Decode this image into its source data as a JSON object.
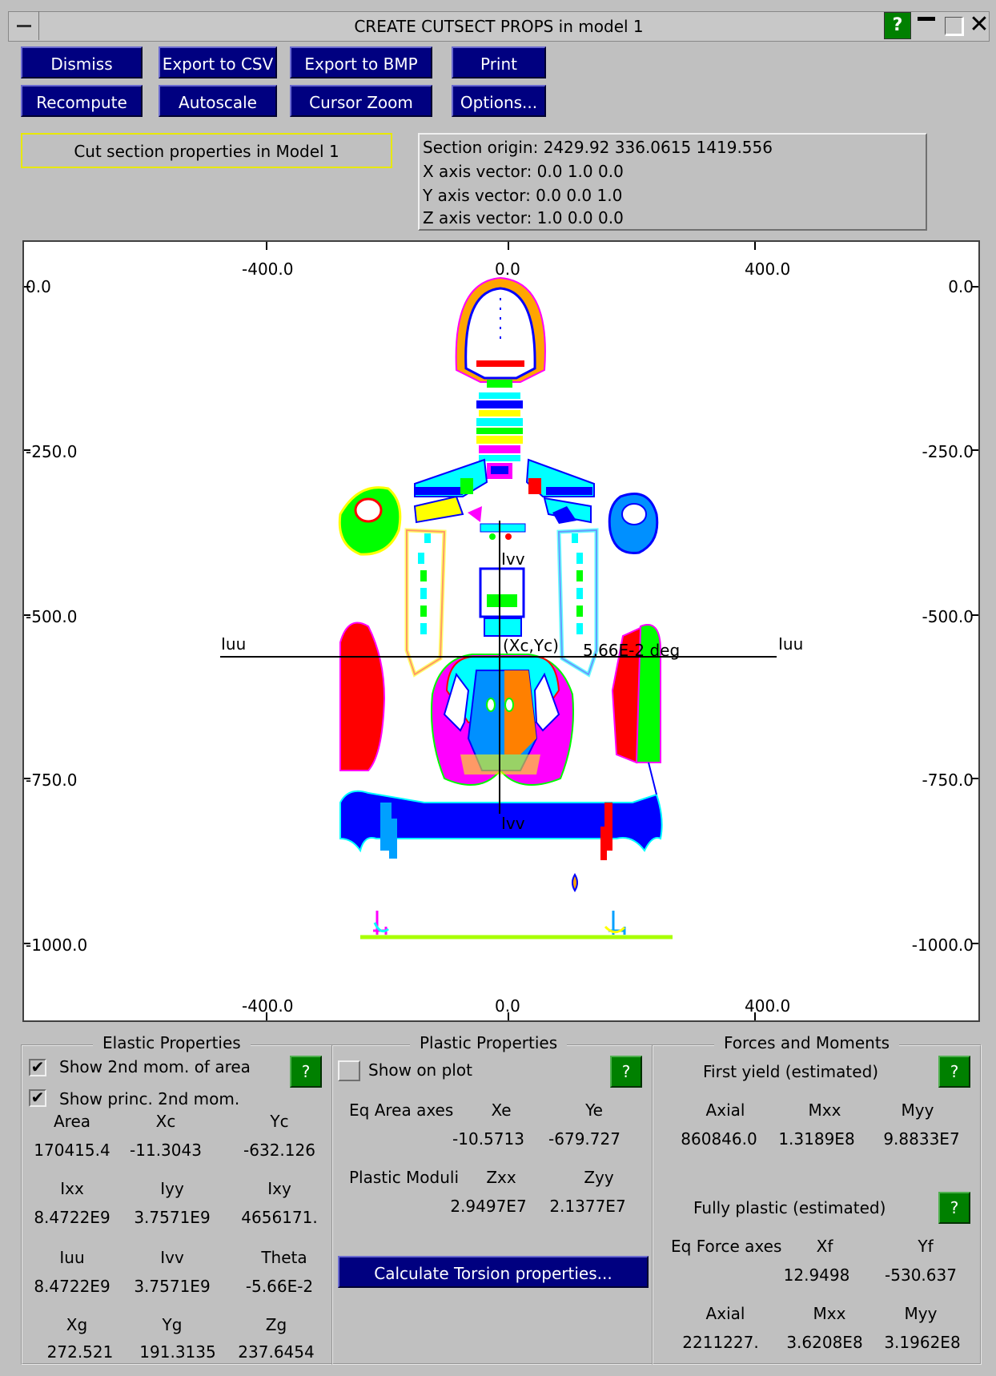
{
  "window": {
    "title": "CREATE CUTSECT PROPS in model 1",
    "help": "?"
  },
  "toolbar": {
    "row1": [
      "Dismiss",
      "Export to CSV",
      "Export to BMP",
      "Print"
    ],
    "row2": [
      "Recompute",
      "Autoscale",
      "Cursor Zoom",
      "Options..."
    ]
  },
  "header": {
    "model_label": "Cut section properties in Model 1",
    "section_origin": "Section origin: 2429.92  336.0615  1419.556",
    "x_axis": "X axis vector:  0.0  1.0  0.0",
    "y_axis": "Y axis vector:  0.0  0.0  1.0",
    "z_axis": "Z axis vector:  1.0  0.0  0.0"
  },
  "plot": {
    "x_ticks": [
      "-400.0",
      "0.0",
      "400.0"
    ],
    "y_ticks": [
      "0.0",
      "-250.0",
      "-500.0",
      "-750.0",
      "-1000.0"
    ],
    "labels": {
      "iuu": "Iuu",
      "ivv": "Ivv",
      "centroid": "(Xc,Yc)",
      "angle": "5.66E-2 deg"
    }
  },
  "elastic": {
    "title": "Elastic Properties",
    "show_2nd": "Show 2nd mom. of area",
    "show_princ": "Show princ. 2nd mom.",
    "h1": [
      "Area",
      "Xc",
      "Yc"
    ],
    "v1": [
      "170415.4",
      "-11.3043",
      "-632.126"
    ],
    "h2": [
      "Ixx",
      "Iyy",
      "Ixy"
    ],
    "v2": [
      "8.4722E9",
      "3.7571E9",
      "4656171."
    ],
    "h3": [
      "Iuu",
      "Ivv",
      "Theta"
    ],
    "v3": [
      "8.4722E9",
      "3.7571E9",
      "-5.66E-2"
    ],
    "h4": [
      "Xg",
      "Yg",
      "Zg"
    ],
    "v4": [
      "272.521",
      "191.3135",
      "237.6454"
    ]
  },
  "plastic": {
    "title": "Plastic Properties",
    "show_on_plot": "Show on plot",
    "eq_area": "Eq Area axes",
    "xe_h": "Xe",
    "ye_h": "Ye",
    "xe": "-10.5713",
    "ye": "-679.727",
    "moduli": "Plastic Moduli",
    "zxx_h": "Zxx",
    "zyy_h": "Zyy",
    "zxx": "2.9497E7",
    "zyy": "2.1377E7",
    "torsion_button": "Calculate Torsion properties..."
  },
  "forces": {
    "title": "Forces and Moments",
    "first_yield": "First yield (estimated)",
    "h1": [
      "Axial",
      "Mxx",
      "Myy"
    ],
    "v1": [
      "860846.0",
      "1.3189E8",
      "9.8833E7"
    ],
    "fully_plastic": "Fully plastic (estimated)",
    "eq_force": "Eq Force axes",
    "xf_h": "Xf",
    "yf_h": "Yf",
    "xf": "12.9498",
    "yf": "-530.637",
    "h2": [
      "Axial",
      "Mxx",
      "Myy"
    ],
    "v2": [
      "2211227.",
      "3.6208E8",
      "3.1962E8"
    ]
  }
}
